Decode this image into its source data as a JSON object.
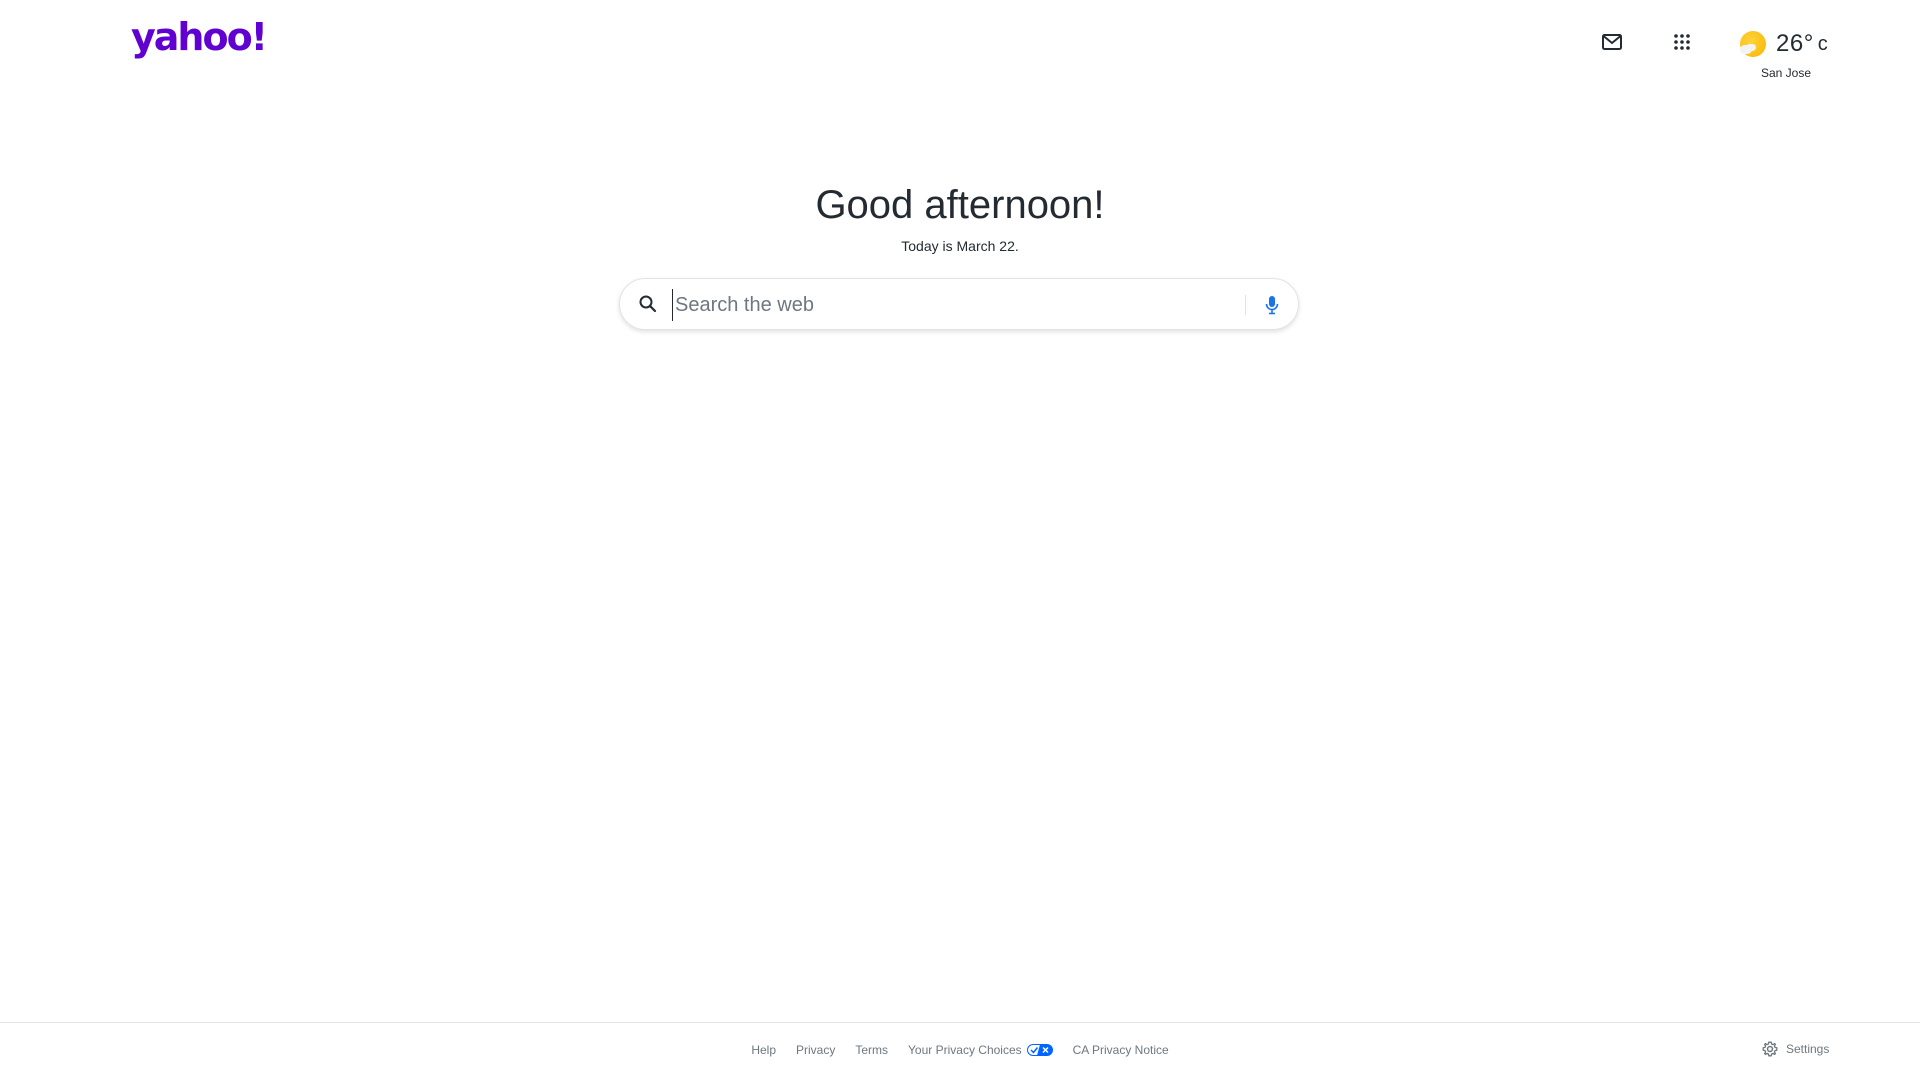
{
  "header": {
    "logo_text": "yahoo!",
    "mail_icon": "mail-icon",
    "apps_icon": "apps-grid-icon",
    "weather": {
      "icon": "partly-sunny-icon",
      "temperature": "26°",
      "unit": "c",
      "city": "San Jose"
    }
  },
  "main": {
    "greeting": "Good afternoon!",
    "date_line": "Today is March 22.",
    "search": {
      "placeholder": "Search the web",
      "value": "",
      "search_icon": "search-icon",
      "mic_icon": "microphone-icon"
    }
  },
  "footer": {
    "links": [
      {
        "label": "Help"
      },
      {
        "label": "Privacy"
      },
      {
        "label": "Terms"
      },
      {
        "label": "Your Privacy Choices",
        "icon": "privacy-choices-icon"
      },
      {
        "label": "CA Privacy Notice"
      }
    ],
    "settings_label": "Settings",
    "settings_icon": "gear-icon"
  },
  "colors": {
    "brand": "#6001d2",
    "text": "#232a31",
    "muted": "#6e7780",
    "mic_blue": "#1a73e8",
    "border": "#e0e4e9"
  }
}
